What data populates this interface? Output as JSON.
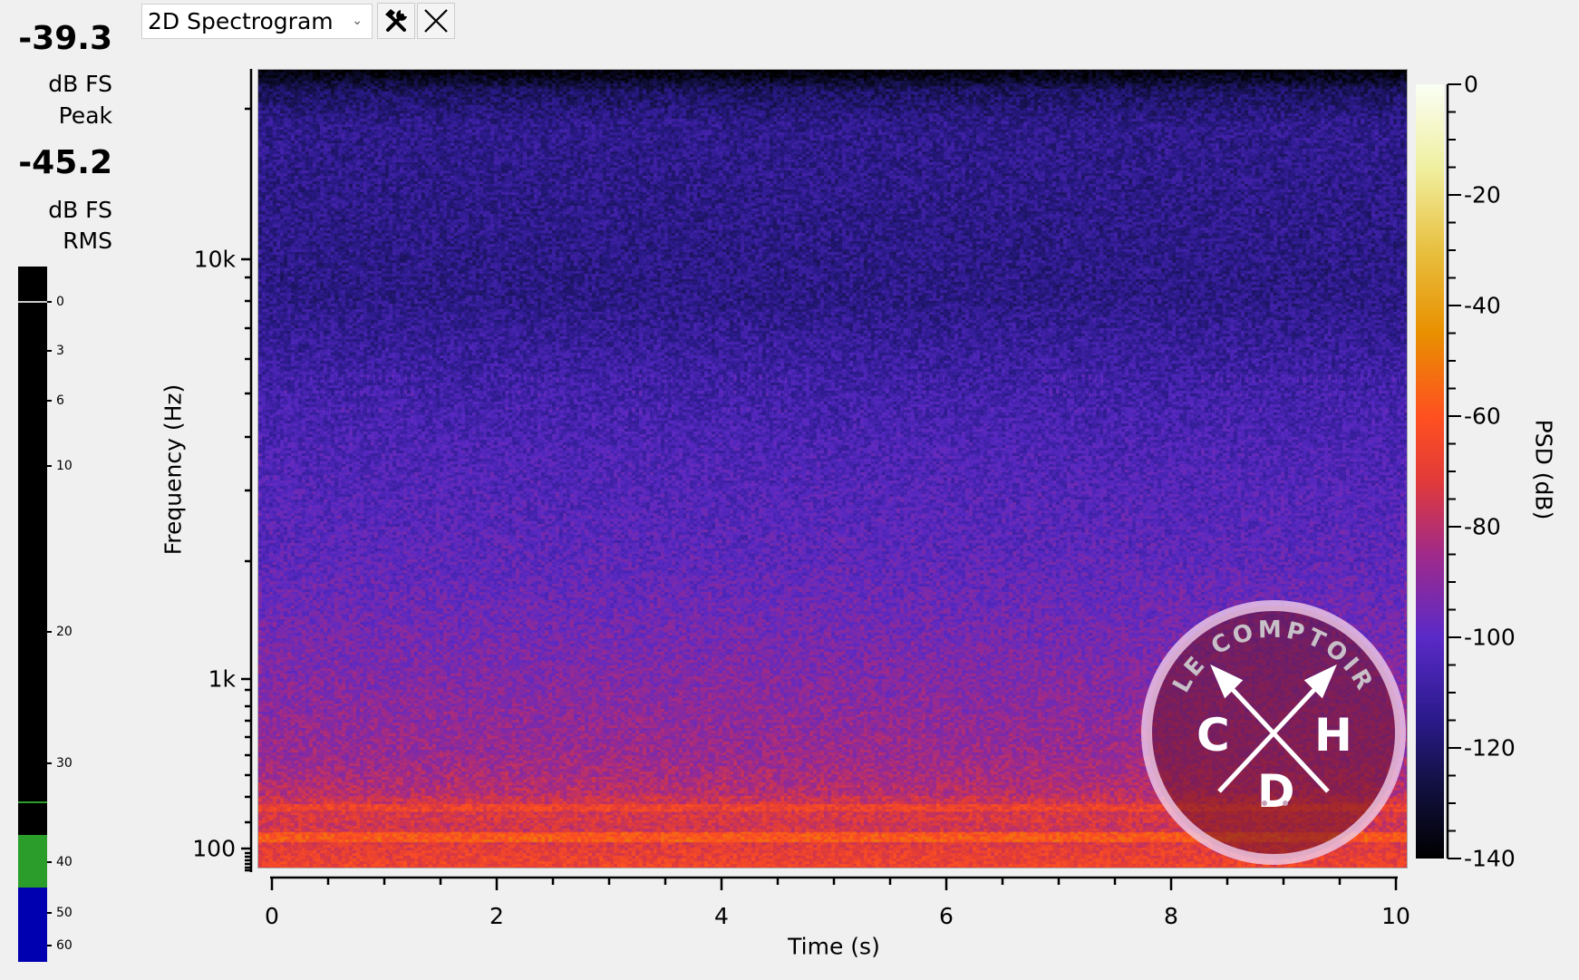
{
  "levels": {
    "peak_value": "-39.3",
    "peak_unit": "dB FS",
    "peak_label": "Peak",
    "rms_value": "-45.2",
    "rms_unit": "dB FS",
    "rms_label": "RMS",
    "meter_scale": [
      "0",
      "3",
      "6",
      "10",
      "20",
      "30",
      "40",
      "50",
      "60"
    ],
    "meter_colors": {
      "peak": "#2a9d2a",
      "rms": "#0000b0",
      "hold_line": "#2a9d2a"
    }
  },
  "toolbar": {
    "view_select": "2D Spectrogram",
    "settings_icon": "hammer-wrench-icon",
    "close_icon": "close-icon"
  },
  "logo": {
    "ring_text": "LE COMPTOIR",
    "letters": [
      "C",
      "H",
      "D"
    ]
  },
  "chart_data": {
    "type": "heatmap",
    "title": "",
    "xlabel": "Time (s)",
    "ylabel": "Frequency (Hz)",
    "xlim": [
      0,
      10
    ],
    "x_ticks": [
      "0",
      "2",
      "4",
      "6",
      "8",
      "10"
    ],
    "y_scale": "log",
    "ylim": [
      90,
      24000
    ],
    "y_ticks": [
      "100",
      "1k",
      "10k"
    ],
    "colorbar": {
      "label": "PSD (dB)",
      "range": [
        -140,
        0
      ],
      "ticks": [
        "0",
        "-20",
        "-40",
        "-60",
        "-80",
        "-100",
        "-120",
        "-140"
      ]
    },
    "description_levels": [
      {
        "freq": "20k+",
        "psd_db": -135
      },
      {
        "freq": "10k",
        "psd_db": -115
      },
      {
        "freq": "5k",
        "psd_db": -108
      },
      {
        "freq": "2k",
        "psd_db": -100
      },
      {
        "freq": "1k",
        "psd_db": -92
      },
      {
        "freq": "300",
        "psd_db": -82
      },
      {
        "freq": "120",
        "psd_db": -58
      },
      {
        "freq": "100",
        "psd_db": -62
      }
    ],
    "colors": [
      "#000000",
      "#121040",
      "#2a1a8a",
      "#5a2ac8",
      "#a02a8a",
      "#e03a3a",
      "#ff5020",
      "#e89000",
      "#e8c040",
      "#f0f0a0",
      "#ffffff"
    ]
  }
}
